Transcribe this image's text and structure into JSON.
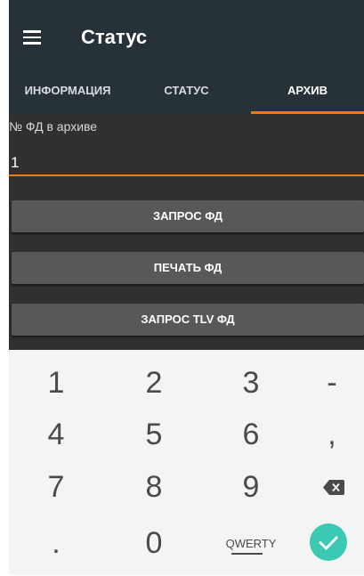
{
  "header": {
    "title": "Статус",
    "menu_icon": "hamburger-menu-icon"
  },
  "tabs": [
    {
      "label": "ИНФОРМАЦИЯ",
      "active": false
    },
    {
      "label": "СТАТУС",
      "active": false
    },
    {
      "label": "АРХИВ",
      "active": true
    }
  ],
  "form": {
    "field_label": "№ ФД в архиве",
    "field_value": "1",
    "buttons": [
      {
        "label": "ЗАПРОС ФД"
      },
      {
        "label": "ПЕЧАТЬ ФД"
      },
      {
        "label": "ЗАПРОС TLV ФД"
      }
    ]
  },
  "keyboard": {
    "rows": [
      [
        "1",
        "2",
        "3",
        "-"
      ],
      [
        "4",
        "5",
        "6",
        ","
      ],
      [
        "7",
        "8",
        "9",
        "backspace-icon"
      ],
      [
        ".",
        "0",
        "QWERTY",
        "check-icon"
      ]
    ]
  },
  "colors": {
    "toolbar": "#263238",
    "accent": "#f57c00",
    "content_bg": "#303030",
    "button_bg": "#585858",
    "keyboard_bg": "#f4f4f4",
    "done_button": "#3cc9b3"
  }
}
